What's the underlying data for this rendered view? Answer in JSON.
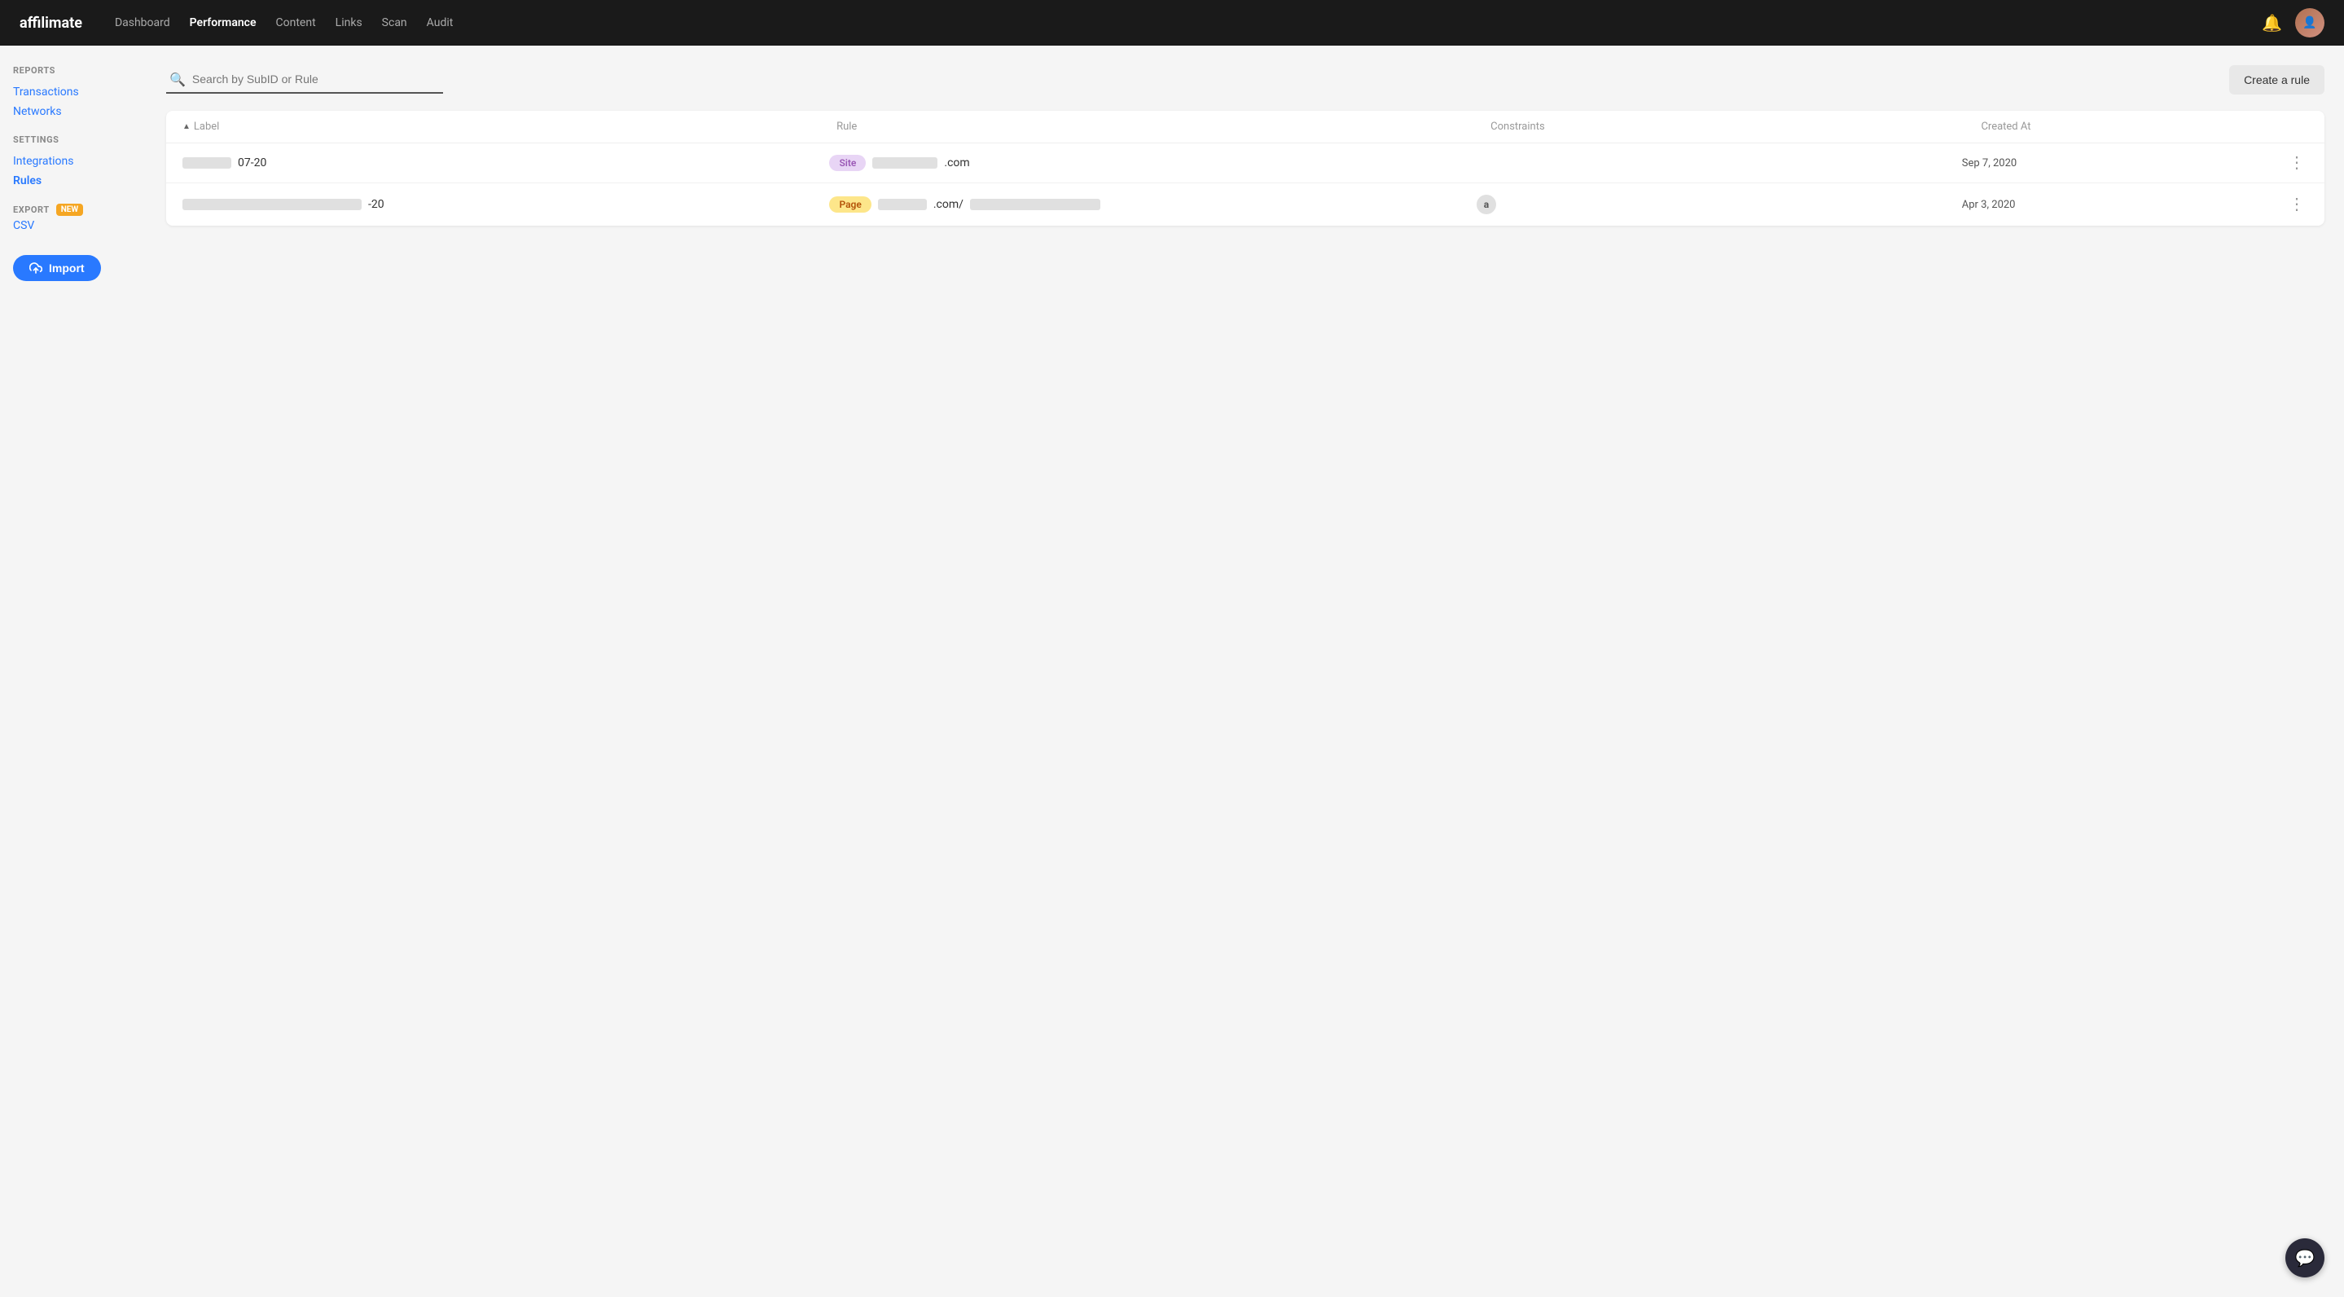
{
  "brand": {
    "name": "affilimate"
  },
  "nav": {
    "links": [
      {
        "label": "Dashboard",
        "active": false
      },
      {
        "label": "Performance",
        "active": true
      },
      {
        "label": "Content",
        "active": false
      },
      {
        "label": "Links",
        "active": false
      },
      {
        "label": "Scan",
        "active": false
      },
      {
        "label": "Audit",
        "active": false
      }
    ]
  },
  "sidebar": {
    "reports_title": "REPORTS",
    "transactions_label": "Transactions",
    "networks_label": "Networks",
    "settings_title": "SETTINGS",
    "integrations_label": "Integrations",
    "rules_label": "Rules",
    "export_title": "EXPORT",
    "new_badge": "NEW",
    "csv_label": "CSV",
    "import_label": "Import"
  },
  "toolbar": {
    "search_placeholder": "Search by SubID or Rule",
    "create_rule_label": "Create a rule"
  },
  "table": {
    "headers": {
      "label": "Label",
      "rule": "Rule",
      "constraints": "Constraints",
      "created_at": "Created At"
    },
    "rows": [
      {
        "label_prefix_width": 60,
        "label_text": "07-20",
        "tag_type": "Site",
        "tag_class": "tag-site",
        "rule_prefix_width": 80,
        "rule_suffix": ".com",
        "rule_suffix2": "",
        "constraints": "",
        "date": "Sep 7, 2020"
      },
      {
        "label_prefix_width": 220,
        "label_text": "-20",
        "tag_type": "Page",
        "tag_class": "tag-page",
        "rule_prefix_width": 60,
        "rule_suffix": ".com/",
        "rule_suffix2": "",
        "constraints": "a",
        "date": "Apr 3, 2020"
      }
    ]
  }
}
